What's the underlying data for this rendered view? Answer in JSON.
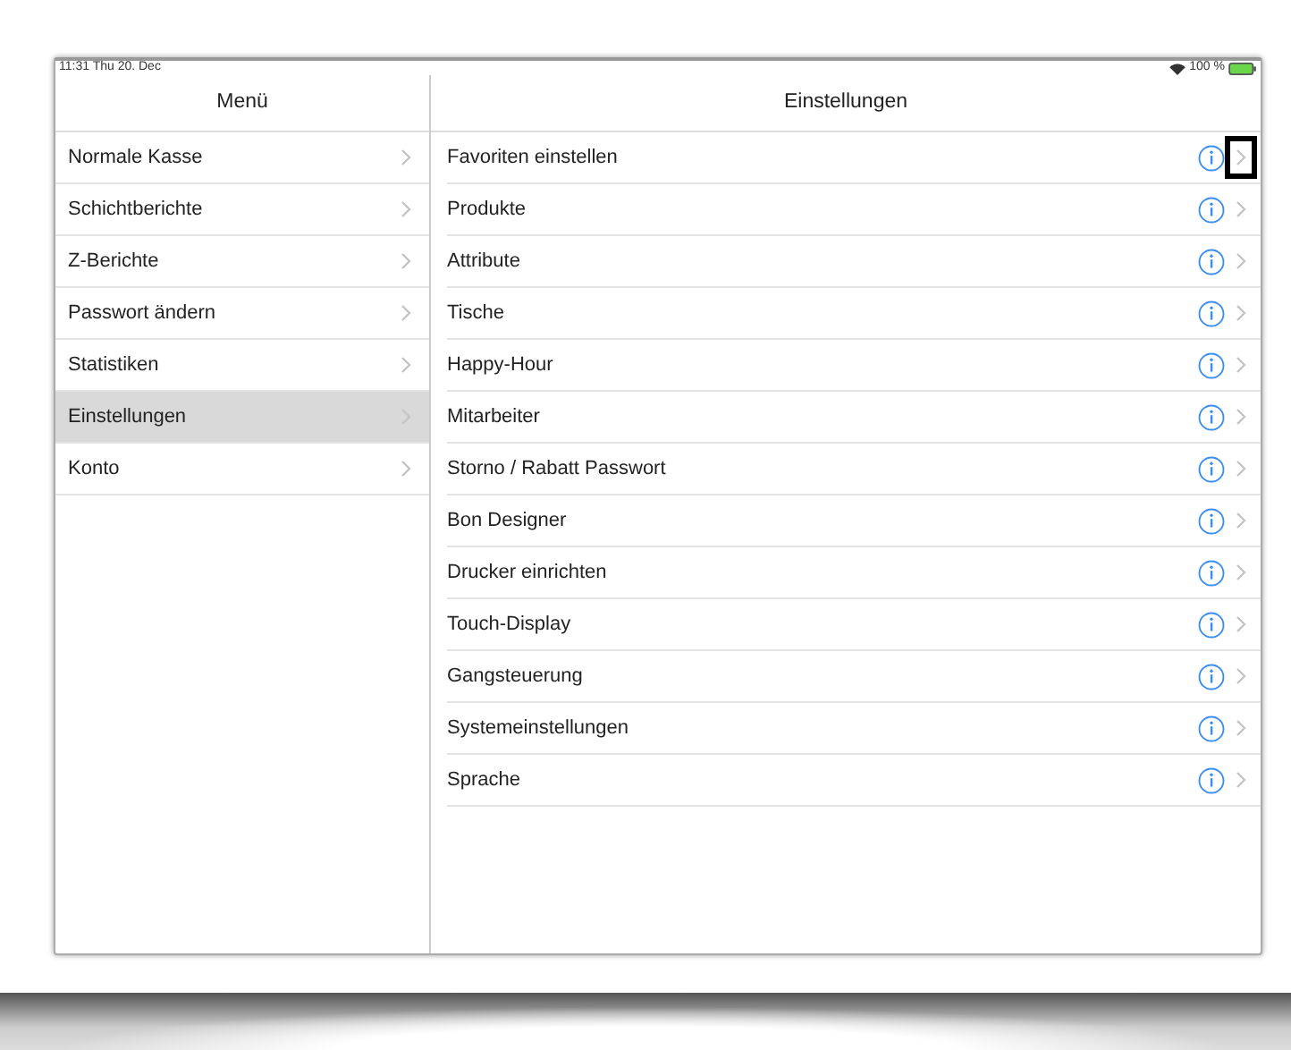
{
  "status_bar": {
    "time": "11:31  Thu 20. Dec",
    "battery": "100 %"
  },
  "menu": {
    "title": "Menü",
    "items": [
      {
        "label": "Normale Kasse",
        "selected": false
      },
      {
        "label": "Schichtberichte",
        "selected": false
      },
      {
        "label": "Z-Berichte",
        "selected": false
      },
      {
        "label": "Passwort ändern",
        "selected": false
      },
      {
        "label": "Statistiken",
        "selected": false
      },
      {
        "label": "Einstellungen",
        "selected": true
      },
      {
        "label": "Konto",
        "selected": false
      }
    ]
  },
  "settings": {
    "title": "Einstellungen",
    "items": [
      {
        "label": "Favoriten einstellen",
        "highlighted": true
      },
      {
        "label": "Produkte",
        "highlighted": false
      },
      {
        "label": "Attribute",
        "highlighted": false
      },
      {
        "label": "Tische",
        "highlighted": false
      },
      {
        "label": "Happy-Hour",
        "highlighted": false
      },
      {
        "label": "Mitarbeiter",
        "highlighted": false
      },
      {
        "label": "Storno / Rabatt Passwort",
        "highlighted": false
      },
      {
        "label": "Bon Designer",
        "highlighted": false
      },
      {
        "label": "Drucker einrichten",
        "highlighted": false
      },
      {
        "label": "Touch-Display",
        "highlighted": false
      },
      {
        "label": "Gangsteuerung",
        "highlighted": false
      },
      {
        "label": "Systemeinstellungen",
        "highlighted": false
      },
      {
        "label": "Sprache",
        "highlighted": false
      }
    ]
  }
}
